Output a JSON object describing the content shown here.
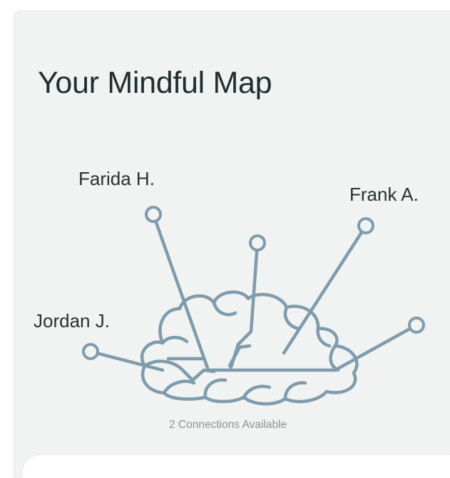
{
  "screen": {
    "title": "Your Mindful Map",
    "status_text": "2 Connections Available"
  },
  "connections": [
    {
      "name": "Farida H."
    },
    {
      "name": "Frank A."
    },
    {
      "name": "Jordan J."
    }
  ],
  "colors": {
    "panel_background": "#f1f2f2",
    "map_line": "#7e9cad",
    "title_text": "#1f2f2e",
    "status_text": "#8d9394"
  },
  "icons": {
    "map_graphic": "brain-connections-icon",
    "node": "connection-node-icon"
  }
}
